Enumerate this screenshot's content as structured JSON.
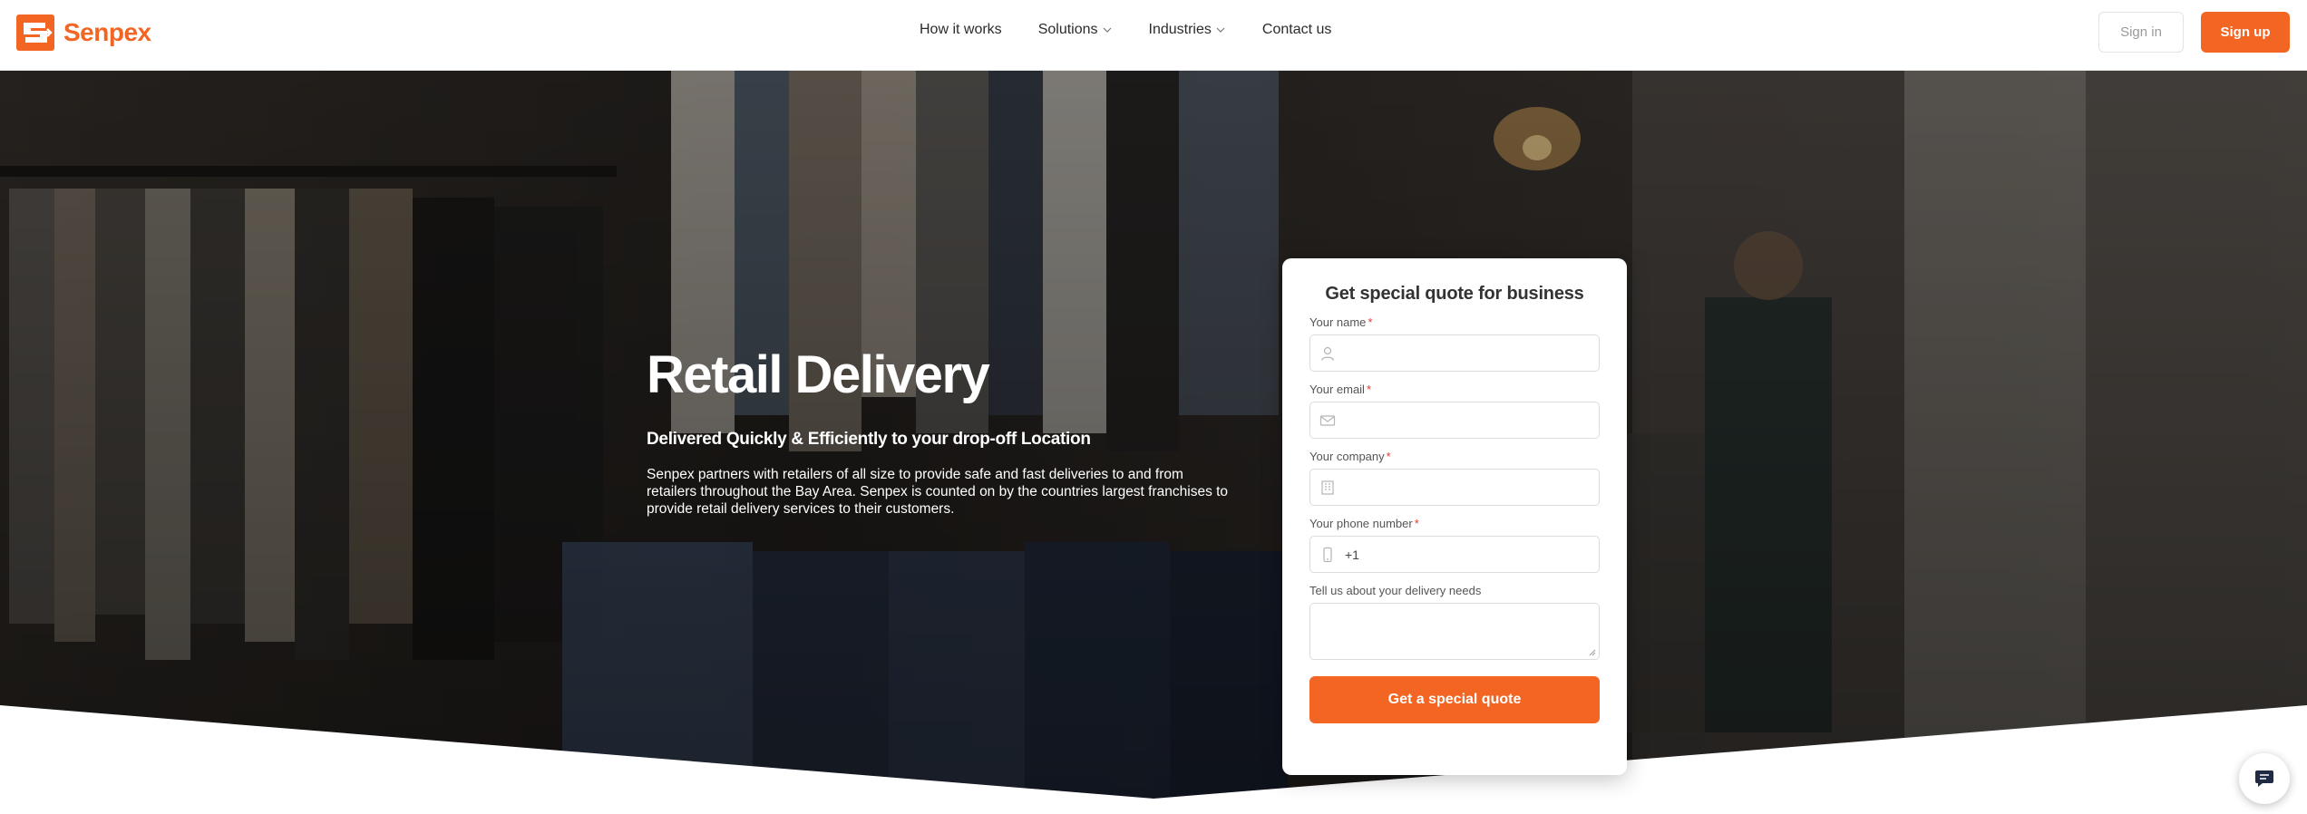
{
  "brand": {
    "name": "Senpex",
    "accent": "#f26522"
  },
  "nav": {
    "items": [
      {
        "label": "How it works",
        "has_dropdown": false
      },
      {
        "label": "Solutions",
        "has_dropdown": true
      },
      {
        "label": "Industries",
        "has_dropdown": true
      },
      {
        "label": "Contact us",
        "has_dropdown": false
      }
    ],
    "signin_label": "Sign in",
    "signup_label": "Sign up"
  },
  "hero": {
    "title": "Retail Delivery",
    "subtitle": "Delivered Quickly & Efficiently to your drop-off Location",
    "description": "Senpex partners with retailers of all size to provide safe and fast deliveries to and from retailers throughout the Bay Area. Senpex is counted on by the countries largest franchises to provide retail delivery services to their customers."
  },
  "quote_form": {
    "title": "Get special quote for business",
    "fields": {
      "name": {
        "label": "Your name",
        "required_mark": "*",
        "icon": "user-icon",
        "value": ""
      },
      "email": {
        "label": "Your email",
        "required_mark": "*",
        "icon": "envelope-icon",
        "value": ""
      },
      "company": {
        "label": "Your company",
        "required_mark": "*",
        "icon": "building-icon",
        "value": ""
      },
      "phone": {
        "label": "Your phone number",
        "required_mark": "*",
        "icon": "phone-icon",
        "value": "+1"
      },
      "needs": {
        "label": "Tell us about your delivery needs",
        "value": ""
      }
    },
    "submit_label": "Get a special quote"
  },
  "chat": {
    "icon": "chat-icon"
  }
}
